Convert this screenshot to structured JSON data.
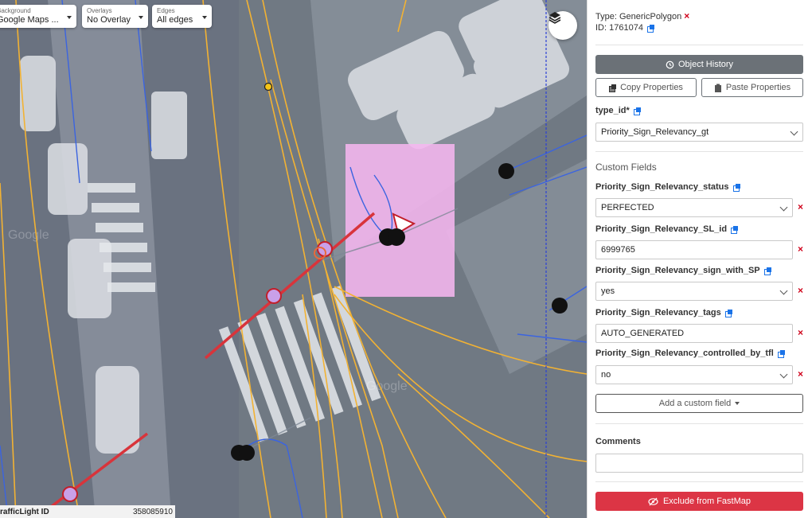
{
  "map": {
    "controls": {
      "background": {
        "label": "Background",
        "value": "Google Maps ..."
      },
      "overlays": {
        "label": "Overlays",
        "value": "No Overlay"
      },
      "edges": {
        "label": "Edges",
        "value": "All edges"
      }
    },
    "status": {
      "left": "rafficLight ID",
      "right": "358085910"
    },
    "watermarks": [
      "Google",
      "Google"
    ],
    "layers_icon": "layers-icon"
  },
  "panel": {
    "type_text": "Type: GenericPolygon",
    "id_text": "ID: 1761074",
    "object_history": "Object History",
    "copy_properties": "Copy Properties",
    "paste_properties": "Paste Properties",
    "type_id": {
      "label": "type_id*",
      "value": "Priority_Sign_Relevancy_gt"
    },
    "custom_fields_title": "Custom Fields",
    "fields": [
      {
        "label": "Priority_Sign_Relevancy_status",
        "value": "PERFECTED"
      },
      {
        "label": "Priority_Sign_Relevancy_SL_id",
        "value": "6999765"
      },
      {
        "label": "Priority_Sign_Relevancy_sign_with_SP",
        "value": "yes"
      },
      {
        "label": "Priority_Sign_Relevancy_tags",
        "value": "AUTO_GENERATED"
      },
      {
        "label": "Priority_Sign_Relevancy_controlled_by_tfl",
        "value": "no"
      }
    ],
    "add_custom_field": "Add a custom field",
    "comments_label": "Comments",
    "comments_value": "",
    "exclude_button": "Exclude from FastMap"
  },
  "colors": {
    "accent": "#1a73e8",
    "danger": "#dc3545",
    "polygon": "#f5b6ef",
    "lane": "#f2b233",
    "edge": "#3b64e0",
    "red_line": "#d8343b"
  }
}
